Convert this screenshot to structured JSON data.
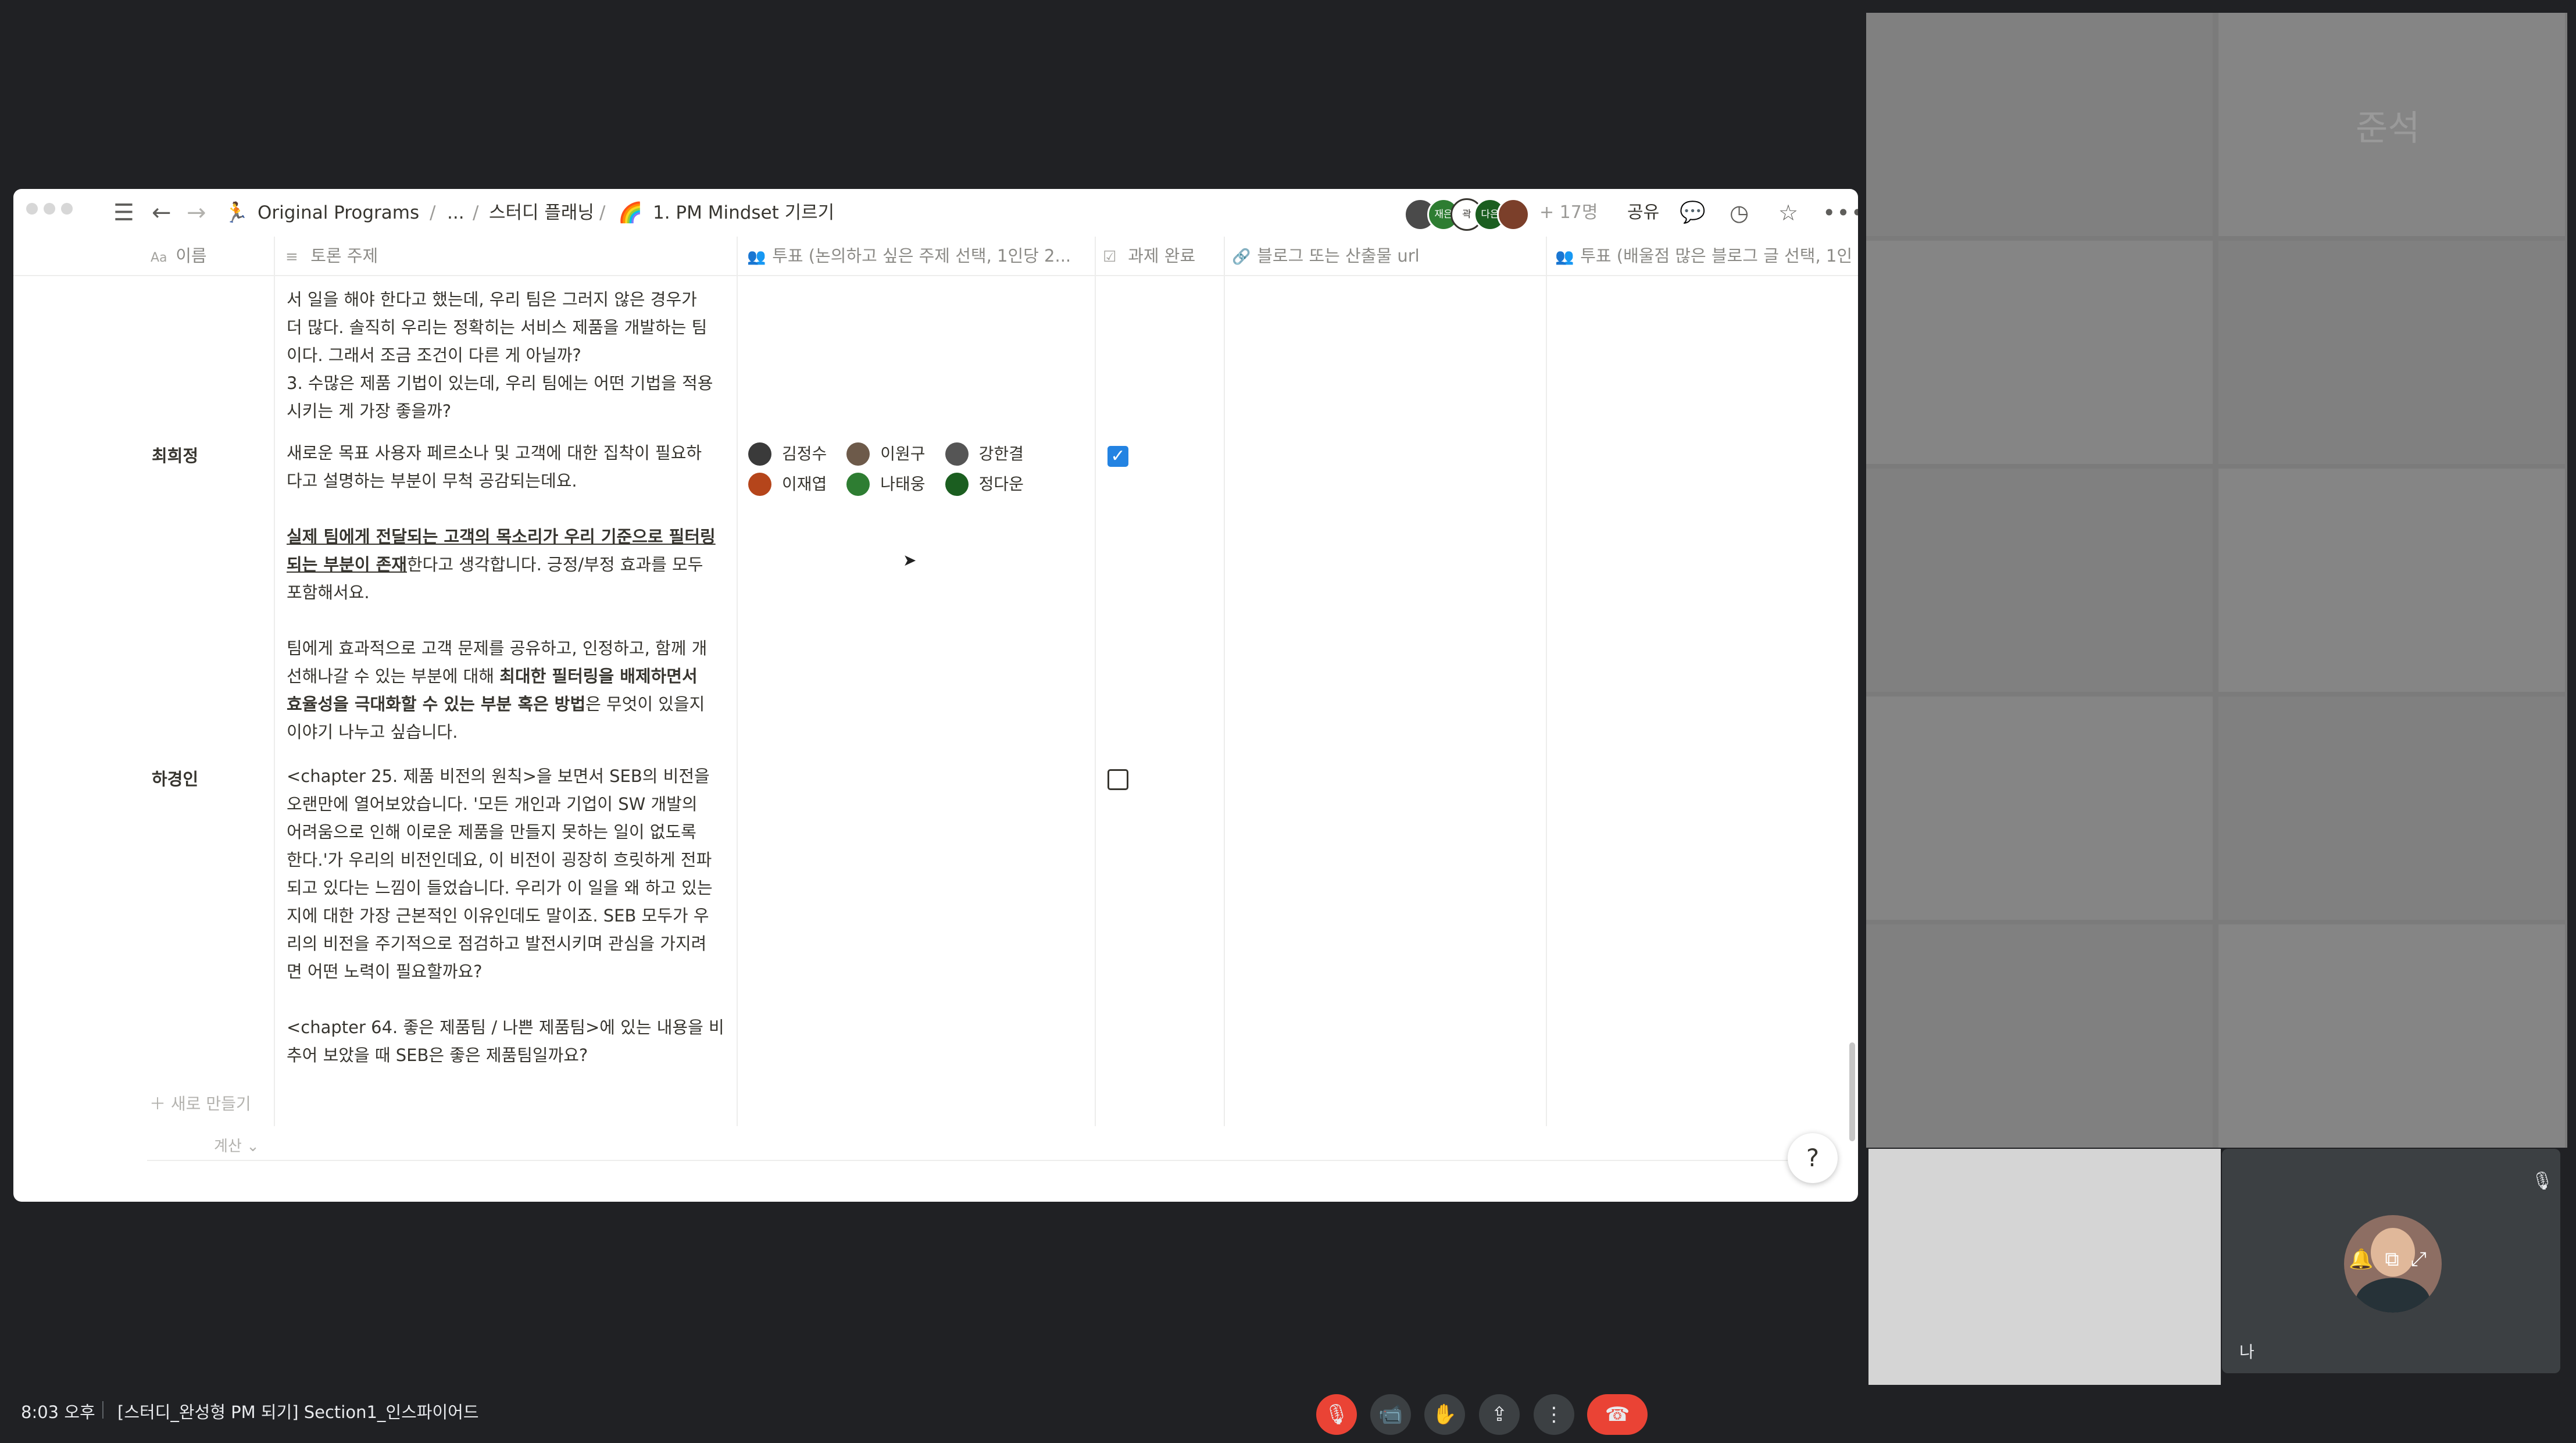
{
  "breadcrumb": {
    "workspace": "Original Programs",
    "ellipsis": "...",
    "parent": "스터디 플래닝",
    "page": "1. PM Mindset 기르기",
    "sep": "/"
  },
  "topbar": {
    "extra_count": "+ 17명",
    "share_label": "공유",
    "avatars": [
      {
        "initials": "",
        "color": "#4a4a4a"
      },
      {
        "initials": "재은",
        "color": "#2e7d32"
      },
      {
        "initials": "곽",
        "color": "#ffffff"
      },
      {
        "initials": "다은",
        "color": "#1b5e20"
      },
      {
        "initials": "",
        "color": "#7b3f2a"
      }
    ]
  },
  "table": {
    "columns": [
      {
        "label": "이름",
        "icon": "Aa"
      },
      {
        "label": "토론 주제",
        "icon": "≡"
      },
      {
        "label": "투표 (논의하고 싶은 주제 선택, 1인당 2...",
        "icon": "👥"
      },
      {
        "label": "과제 완료",
        "icon": "☑"
      },
      {
        "label": "블로그 또는 산출물 url",
        "icon": "🔗"
      },
      {
        "label": "투표 (배울점 많은 블로그 글 선택, 1인",
        "icon": "👥"
      }
    ],
    "partial_row_text": "서 일을 해야 한다고 했는데, 우리 팀은 그러지 않은 경우가\n더 많다. 솔직히 우리는 정확히는 서비스 제품을 개발하는 팀\n이다. 그래서 조금 조건이 다른 게 아닐까?\n3. 수많은 제품 기법이 있는데, 우리 팀에는 어떤 기법을 적용\n시키는 게 가장 좋을까?",
    "row1": {
      "name": "최희정",
      "p1": "새로운 목표 사용자 페르소나 및 고객에 대한 집착이 필요하\n다고 설명하는 부분이 무척 공감되는데요.",
      "p2_underlined": "실제 팀에게 전달되는 고객의 목소리가 우리 기준으로 필터링\n되는 부분이 존재",
      "p2_rest": "한다고 생각합니다. 긍정/부정 효과를 모두\n포함해서요.",
      "p3a": "팀에게 효과적으로 고객 문제를 공유하고, 인정하고, 함께 개\n선해나갈 수 있는 부분에 대해 ",
      "p3b": "최대한 필터링을 배제하면서\n효율성을 극대화할 수 있는 부분 혹은 방법",
      "p3c": "은 무엇이 있을지\n이야기 나누고 싶습니다.",
      "voters": [
        {
          "name": "김정수",
          "color": "#3a3a3a"
        },
        {
          "name": "이원구",
          "color": "#6d5a4a"
        },
        {
          "name": "강한결",
          "color": "#555555"
        },
        {
          "name": "이재엽",
          "color": "#b5451b"
        },
        {
          "name": "나태웅",
          "color": "#2e7d32"
        },
        {
          "name": "정다운",
          "color": "#1b5e20"
        }
      ],
      "done": true
    },
    "row2": {
      "name": "하경인",
      "p1": "<chapter 25. 제품 비전의 원칙>을 보면서 SEB의 비전을\n오랜만에 열어보았습니다. '모든 개인과 기업이 SW 개발의\n어려움으로 인해 이로운 제품을 만들지 못하는 일이 없도록\n한다.'가 우리의 비전인데요, 이 비전이 굉장히 흐릿하게 전파\n되고 있다는 느낌이 들었습니다. 우리가 이 일을 왜 하고 있는\n지에 대한 가장 근본적인 이유인데도 말이죠. SEB 모두가 우\n리의 비전을 주기적으로 점검하고 발전시키며 관심을 가지려\n면 어떤 노력이 필요할까요?",
      "p2": "<chapter 64. 좋은 제품팀 / 나쁜 제품팀>에 있는 내용을 비\n추어 보았을 때 SEB은 좋은 제품팀일까요?",
      "done": false
    },
    "new_label": "새로 만들기",
    "calc_label": "계산"
  },
  "help_label": "?",
  "meet": {
    "time": "8:03 오후",
    "meeting_title": "[스터디_완성형 PM 되기] Section1_인스파이어드",
    "self_label": "나",
    "watermark": "준석"
  },
  "colors": {
    "accent_blue": "#2383e2",
    "meet_red": "#ea4335",
    "meet_bg": "#202124"
  }
}
